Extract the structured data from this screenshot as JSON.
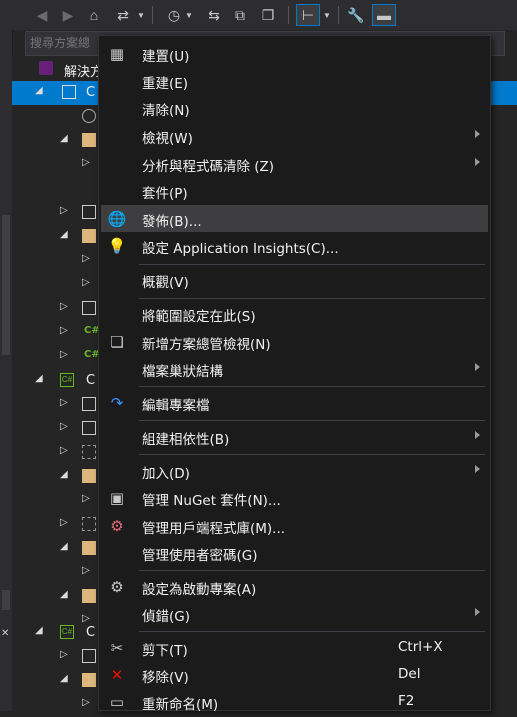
{
  "toolbar": {
    "icons": [
      "back-icon",
      "forward-icon",
      "home-icon",
      "sync-icon",
      "dropdown-arrow-icon",
      "history-icon",
      "dropdown-arrow-icon",
      "pending-changes-icon",
      "collapse-all-icon",
      "copy-icon",
      "show-all-files-icon",
      "properties-icon",
      "preview-icon"
    ]
  },
  "search": {
    "placeholder": "搜尋方案總"
  },
  "tree": {
    "solution_label": "解決方",
    "project1_label": "C",
    "project2_label": "C",
    "project3_label": "C",
    "cs_badge": "C#"
  },
  "menu": {
    "build": "建置(U)",
    "rebuild": "重建(E)",
    "clean": "清除(N)",
    "view": "檢視(W)",
    "analyze": "分析與程式碼清除 (Z)",
    "package": "套件(P)",
    "publish": "發佈(B)...",
    "app_insights": "設定 Application Insights(C)...",
    "overview": "概觀(V)",
    "scope": "將範圍設定在此(S)",
    "new_solution_view": "新增方案總管檢視(N)",
    "file_nesting": "檔案巢狀結構",
    "edit_project": "編輯專案檔",
    "build_dependencies": "組建相依性(B)",
    "add": "加入(D)",
    "nuget": "管理 NuGet 套件(N)...",
    "client_libraries": "管理用戶端程式庫(M)...",
    "user_secrets": "管理使用者密碼(G)",
    "set_startup": "設定為啟動專案(A)",
    "debug": "偵錯(G)",
    "cut": "剪下(T)",
    "cut_shortcut": "Ctrl+X",
    "remove": "移除(V)",
    "remove_shortcut": "Del",
    "rename": "重新命名(M)",
    "rename_shortcut": "F2"
  },
  "colors": {
    "accent": "#007acc",
    "menu_bg": "#1b1b1c",
    "highlight": "#3e3e40",
    "remove_icon": "#e51400",
    "csharp_green": "#68b723"
  }
}
